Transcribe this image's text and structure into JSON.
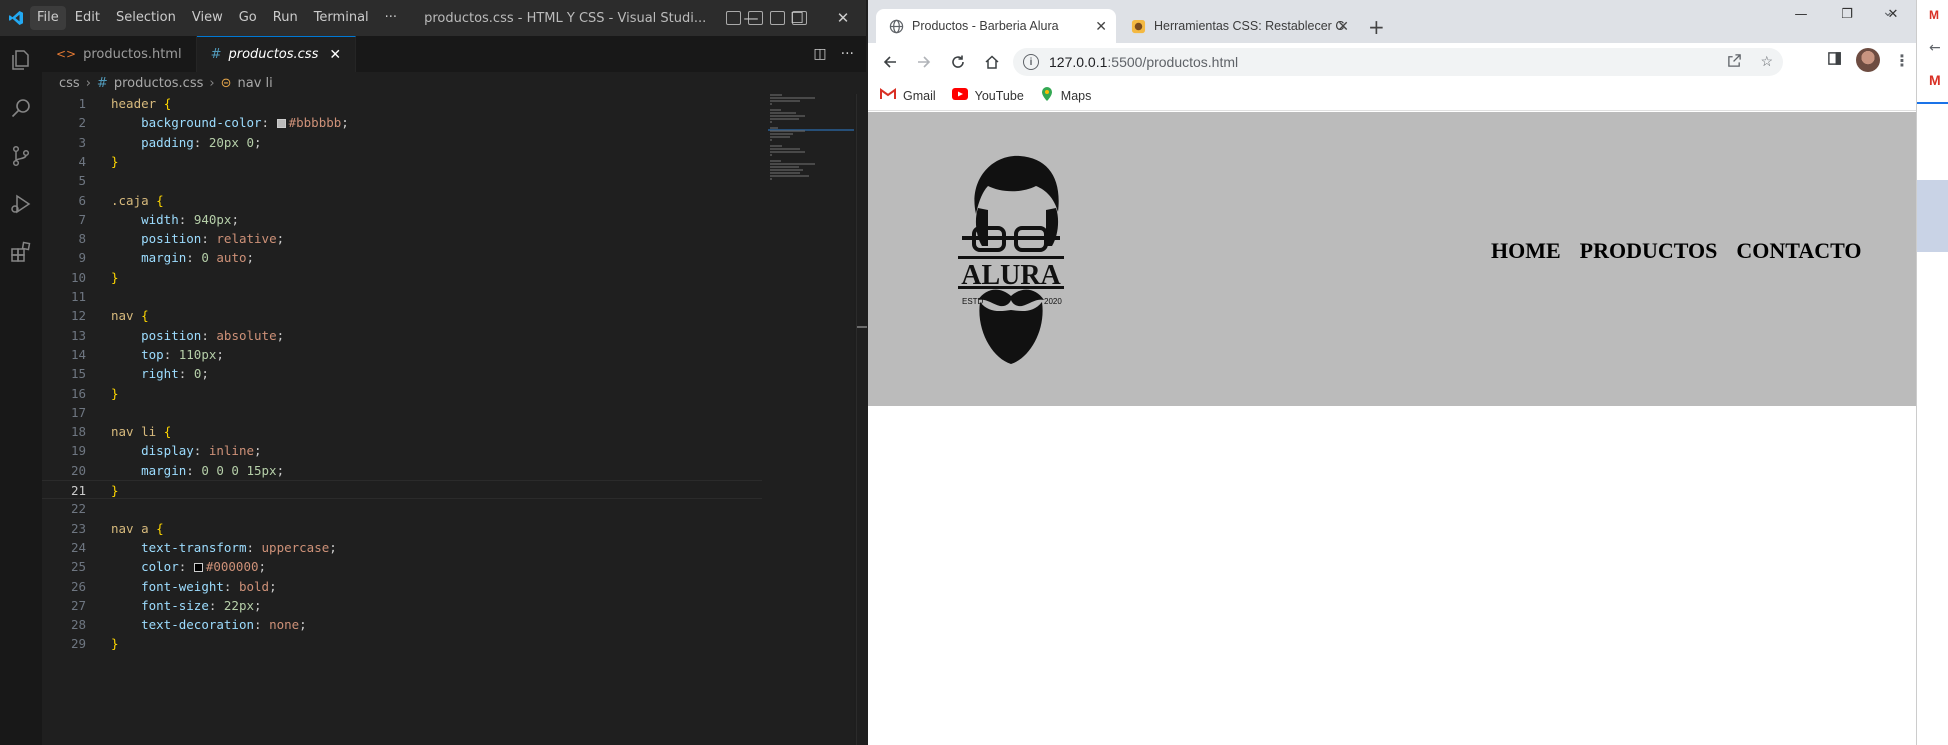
{
  "vscode": {
    "menu": [
      "File",
      "Edit",
      "Selection",
      "View",
      "Go",
      "Run",
      "Terminal",
      "···"
    ],
    "window_title": "productos.css - HTML Y CSS - Visual Studi...",
    "tabs": [
      {
        "label": "productos.html",
        "icon": "html-file-icon"
      },
      {
        "label": "productos.css",
        "icon": "css-file-icon",
        "active": true
      }
    ],
    "breadcrumb": [
      "css",
      "productos.css",
      "nav li"
    ],
    "current_line": 21,
    "code_lines": [
      [
        [
          "sel",
          "header"
        ],
        [
          "pun",
          " "
        ],
        [
          "brace",
          "{"
        ]
      ],
      [
        [
          "pun",
          "    "
        ],
        [
          "prop",
          "background-color"
        ],
        [
          "pun",
          ": "
        ],
        [
          "swatch",
          "#bbbbbb"
        ],
        [
          "val",
          "#bbbbbb"
        ],
        [
          "pun",
          ";"
        ]
      ],
      [
        [
          "pun",
          "    "
        ],
        [
          "prop",
          "padding"
        ],
        [
          "pun",
          ": "
        ],
        [
          "num",
          "20px 0"
        ],
        [
          "pun",
          ";"
        ]
      ],
      [
        [
          "brace",
          "}"
        ]
      ],
      [],
      [
        [
          "sel",
          ".caja"
        ],
        [
          "pun",
          " "
        ],
        [
          "brace",
          "{"
        ]
      ],
      [
        [
          "pun",
          "    "
        ],
        [
          "prop",
          "width"
        ],
        [
          "pun",
          ": "
        ],
        [
          "num",
          "940px"
        ],
        [
          "pun",
          ";"
        ]
      ],
      [
        [
          "pun",
          "    "
        ],
        [
          "prop",
          "position"
        ],
        [
          "pun",
          ": "
        ],
        [
          "val",
          "relative"
        ],
        [
          "pun",
          ";"
        ]
      ],
      [
        [
          "pun",
          "    "
        ],
        [
          "prop",
          "margin"
        ],
        [
          "pun",
          ": "
        ],
        [
          "num",
          "0"
        ],
        [
          "pun",
          " "
        ],
        [
          "val",
          "auto"
        ],
        [
          "pun",
          ";"
        ]
      ],
      [
        [
          "brace",
          "}"
        ]
      ],
      [],
      [
        [
          "sel",
          "nav"
        ],
        [
          "pun",
          " "
        ],
        [
          "brace",
          "{"
        ]
      ],
      [
        [
          "pun",
          "    "
        ],
        [
          "prop",
          "position"
        ],
        [
          "pun",
          ": "
        ],
        [
          "val",
          "absolute"
        ],
        [
          "pun",
          ";"
        ]
      ],
      [
        [
          "pun",
          "    "
        ],
        [
          "prop",
          "top"
        ],
        [
          "pun",
          ": "
        ],
        [
          "num",
          "110px"
        ],
        [
          "pun",
          ";"
        ]
      ],
      [
        [
          "pun",
          "    "
        ],
        [
          "prop",
          "right"
        ],
        [
          "pun",
          ": "
        ],
        [
          "num",
          "0"
        ],
        [
          "pun",
          ";"
        ]
      ],
      [
        [
          "brace",
          "}"
        ]
      ],
      [],
      [
        [
          "sel",
          "nav li"
        ],
        [
          "pun",
          " "
        ],
        [
          "brace",
          "{"
        ]
      ],
      [
        [
          "pun",
          "    "
        ],
        [
          "prop",
          "display"
        ],
        [
          "pun",
          ": "
        ],
        [
          "val",
          "inline"
        ],
        [
          "pun",
          ";"
        ]
      ],
      [
        [
          "pun",
          "    "
        ],
        [
          "prop",
          "margin"
        ],
        [
          "pun",
          ": "
        ],
        [
          "num",
          "0 0 0 15px"
        ],
        [
          "pun",
          ";"
        ]
      ],
      [
        [
          "brace",
          "}"
        ]
      ],
      [],
      [
        [
          "sel",
          "nav a"
        ],
        [
          "pun",
          " "
        ],
        [
          "brace",
          "{"
        ]
      ],
      [
        [
          "pun",
          "    "
        ],
        [
          "prop",
          "text-transform"
        ],
        [
          "pun",
          ": "
        ],
        [
          "val",
          "uppercase"
        ],
        [
          "pun",
          ";"
        ]
      ],
      [
        [
          "pun",
          "    "
        ],
        [
          "prop",
          "color"
        ],
        [
          "pun",
          ": "
        ],
        [
          "swatch",
          "#000000"
        ],
        [
          "val",
          "#000000"
        ],
        [
          "pun",
          ";"
        ]
      ],
      [
        [
          "pun",
          "    "
        ],
        [
          "prop",
          "font-weight"
        ],
        [
          "pun",
          ": "
        ],
        [
          "val",
          "bold"
        ],
        [
          "pun",
          ";"
        ]
      ],
      [
        [
          "pun",
          "    "
        ],
        [
          "prop",
          "font-size"
        ],
        [
          "pun",
          ": "
        ],
        [
          "num",
          "22px"
        ],
        [
          "pun",
          ";"
        ]
      ],
      [
        [
          "pun",
          "    "
        ],
        [
          "prop",
          "text-decoration"
        ],
        [
          "pun",
          ": "
        ],
        [
          "val",
          "none"
        ],
        [
          "pun",
          ";"
        ]
      ],
      [
        [
          "brace",
          "}"
        ]
      ]
    ]
  },
  "chrome": {
    "tabs": [
      {
        "title": "Productos - Barberia Alura",
        "active": true
      },
      {
        "title": "Herramientas CSS: Restablecer C"
      }
    ],
    "new_tab": "+",
    "url_host": "127.0.0.1",
    "url_path": ":5500/productos.html",
    "bookmarks": [
      {
        "label": "Gmail",
        "icon": "gmail-icon"
      },
      {
        "label": "YouTube",
        "icon": "youtube-icon"
      },
      {
        "label": "Maps",
        "icon": "maps-icon"
      }
    ]
  },
  "page": {
    "logo": {
      "name": "ALURA",
      "left": "ESTD",
      "right": "2020"
    },
    "nav": [
      "HOME",
      "PRODUCTOS",
      "CONTACTO"
    ],
    "header_bg": "#bbbbbb"
  }
}
